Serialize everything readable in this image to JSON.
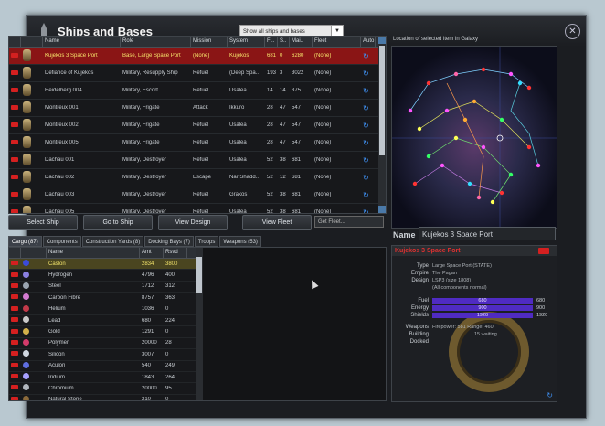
{
  "window": {
    "title": "Ships and Bases",
    "filter": "Show all ships and bases",
    "close_icon": "close-icon"
  },
  "ships_table": {
    "columns": [
      "",
      "",
      "Name",
      "Role",
      "Mission",
      "System",
      "Fl..",
      "S..",
      "Mai..",
      "Fleet",
      "Auto"
    ],
    "rows": [
      {
        "name": "Kujekos 3 Space Port",
        "role": "Base, Large Space Port",
        "mission": "(None)",
        "system": "Kujekos",
        "fl": "681",
        "s": "0",
        "mai": "6280",
        "fleet": "(None)",
        "selected": true
      },
      {
        "name": "Defiance of Kujekos",
        "role": "Military, Resupply Ship",
        "mission": "Refuel",
        "system": "(Deep Spa..",
        "fl": "193",
        "s": "3",
        "mai": "3022",
        "fleet": "(None)",
        "selected": false
      },
      {
        "name": "Heidelberg 004",
        "role": "Military, Escort",
        "mission": "Refuel",
        "system": "Usalea",
        "fl": "14",
        "s": "14",
        "mai": "375",
        "fleet": "(None)",
        "selected": false
      },
      {
        "name": "Montreux 001",
        "role": "Military, Frigate",
        "mission": "Attack",
        "system": "Ikkuro",
        "fl": "28",
        "s": "47",
        "mai": "547",
        "fleet": "(None)",
        "selected": false
      },
      {
        "name": "Montreux 002",
        "role": "Military, Frigate",
        "mission": "Refuel",
        "system": "Usalea",
        "fl": "28",
        "s": "47",
        "mai": "547",
        "fleet": "(None)",
        "selected": false
      },
      {
        "name": "Montreux 005",
        "role": "Military, Frigate",
        "mission": "Refuel",
        "system": "Usalea",
        "fl": "28",
        "s": "47",
        "mai": "547",
        "fleet": "(None)",
        "selected": false
      },
      {
        "name": "Dachau 001",
        "role": "Military, Destroyer",
        "mission": "Refuel",
        "system": "Usalea",
        "fl": "52",
        "s": "38",
        "mai": "681",
        "fleet": "(None)",
        "selected": false
      },
      {
        "name": "Dachau 002",
        "role": "Military, Destroyer",
        "mission": "Escape",
        "system": "Nar Shadd..",
        "fl": "52",
        "s": "12",
        "mai": "681",
        "fleet": "(None)",
        "selected": false
      },
      {
        "name": "Dachau 003",
        "role": "Military, Destroyer",
        "mission": "Refuel",
        "system": "Grakos",
        "fl": "52",
        "s": "38",
        "mai": "681",
        "fleet": "(None)",
        "selected": false
      },
      {
        "name": "Dachau 005",
        "role": "Military, Destroyer",
        "mission": "Refuel",
        "system": "Usalea",
        "fl": "52",
        "s": "38",
        "mai": "681",
        "fleet": "(None)",
        "selected": false
      }
    ]
  },
  "buttons": {
    "select_ship": "Select Ship",
    "go_to_ship": "Go to Ship",
    "view_design": "View Design",
    "view_fleet": "View Fleet",
    "get_fleet": "Get Fleet..."
  },
  "tabs": [
    "Cargo (87)",
    "Components",
    "Construction Yards (8)",
    "Docking Bays (7)",
    "Troops",
    "Weapons (53)"
  ],
  "cargo": {
    "columns": [
      "",
      "",
      "Name",
      "Amt",
      "Rsvd"
    ],
    "rows": [
      {
        "name": "Caslon",
        "amt": "2834",
        "rsvd": "3800",
        "color": "#3b4bd8",
        "selected": true
      },
      {
        "name": "Hydrogen",
        "amt": "4796",
        "rsvd": "400",
        "color": "#8a7fe0",
        "selected": false
      },
      {
        "name": "Steel",
        "amt": "1712",
        "rsvd": "312",
        "color": "#9aa4b0",
        "selected": false
      },
      {
        "name": "Carbon Fibre",
        "amt": "8757",
        "rsvd": "363",
        "color": "#d27ad0",
        "selected": false
      },
      {
        "name": "Helium",
        "amt": "1036",
        "rsvd": "0",
        "color": "#c23a4a",
        "selected": false
      },
      {
        "name": "Lead",
        "amt": "680",
        "rsvd": "224",
        "color": "#c9c9c9",
        "selected": false
      },
      {
        "name": "Gold",
        "amt": "1291",
        "rsvd": "0",
        "color": "#d2b04a",
        "selected": false
      },
      {
        "name": "Polymer",
        "amt": "20000",
        "rsvd": "28",
        "color": "#d33a6a",
        "selected": false
      },
      {
        "name": "Silicon",
        "amt": "3007",
        "rsvd": "0",
        "color": "#cfd6df",
        "selected": false
      },
      {
        "name": "Aculon",
        "amt": "540",
        "rsvd": "249",
        "color": "#5f6ee0",
        "selected": false
      },
      {
        "name": "Iridium",
        "amt": "1843",
        "rsvd": "264",
        "color": "#a7a0ff",
        "selected": false
      },
      {
        "name": "Chromium",
        "amt": "20000",
        "rsvd": "95",
        "color": "#b0b6bd",
        "selected": false
      },
      {
        "name": "Natural Stone",
        "amt": "210",
        "rsvd": "0",
        "color": "#8b6a3a",
        "selected": false
      }
    ]
  },
  "map": {
    "label": "Location of selected item in Galaxy"
  },
  "details": {
    "name_label": "Name",
    "name_value": "Kujekos 3 Space Port",
    "header": "Kujekos 3 Space Port",
    "type_label": "Type",
    "type_value": "Large Space Port (STATE)",
    "empire_label": "Empire",
    "empire_value": "The Pagan",
    "design_label": "Design",
    "design_value": "LSP3 (size 1808)",
    "design_note": "(All components normal)",
    "fuel_label": "Fuel",
    "fuel_bar": "680",
    "fuel_value": "680",
    "energy_label": "Energy",
    "energy_bar": "900",
    "energy_value": "900",
    "shields_label": "Shields",
    "shields_bar": "1920",
    "shields_value": "1920",
    "weapons_label": "Weapons",
    "weapons_value": "Firepower: 581 Range: 460",
    "building_label": "Building",
    "building_value": "15 waiting",
    "docked_label": "Docked"
  },
  "colors": {
    "selection": "#8a1515",
    "accent": "#3f8ff0",
    "delete": "#d42020",
    "bar": "#4f2bc2"
  }
}
